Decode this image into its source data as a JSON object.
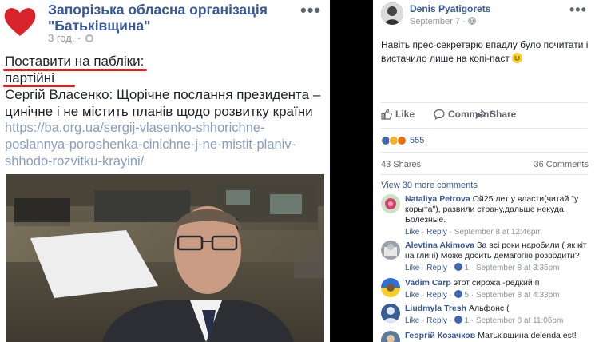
{
  "left_post": {
    "page_name_line1": "Запорізька обласна організація",
    "page_name_line2": "\"Батьківщина\"",
    "time": "3 год.",
    "meta_sep": "·",
    "more": "•••",
    "text_lines": [
      "Поставити на пабліки:",
      "партійні",
      "Сергій Власенко: Щорічне послання президента –",
      "цинічне і не містить планів щодо розвитку країни"
    ],
    "link_lines": [
      "https://ba.org.ua/sergij-vlasenko-shhorichne-",
      "poslannya-poroshenka-cinichne-j-ne-mistit-planiv-",
      "shhodo-rozvitku-krayini/"
    ]
  },
  "right_post": {
    "author": "Denis Pyatigorets",
    "date": "September 7 · ",
    "more": "•••",
    "text": "Навіть прес-секретарю впадлу було почитати і вистачило лише на копі-паст ",
    "actions": {
      "like": "Like",
      "comment": "Comment",
      "share": "Share"
    },
    "reaction_count": "555",
    "shares": "43 Shares",
    "comments_count": "36 Comments",
    "view_more": "View 30 more comments",
    "comments": [
      {
        "name": "Nataliya Petrova",
        "text": "Ой25 лет у власти(читай \"у корыта\"), развили страну,дальше некуда. Болезные.",
        "like": "Like",
        "reply": "Reply",
        "likes": "",
        "date": "September 8 at 12:46pm"
      },
      {
        "name": "Alevtina Akimova",
        "text": "За всі роки наробили ( як кіт на глині) Може досить демагогію розводити?",
        "like": "Like",
        "reply": "Reply",
        "likes": "1",
        "date": "September 8 at 3:35pm"
      },
      {
        "name": "Vadim Carp",
        "text": "этот сирожа -редкий п",
        "like": "Like",
        "reply": "Reply",
        "likes": "5",
        "date": "September 8 at 4:33pm"
      },
      {
        "name": "Liudmyla Tresh",
        "text": "Альфонс (",
        "like": "Like",
        "reply": "Reply",
        "likes": "1",
        "date": "September 8 at 11:06pm"
      },
      {
        "name": "Георгій Козачков",
        "text": "Матьківщина delenda est!",
        "like": "Like",
        "reply": "Reply",
        "likes": "",
        "date": ""
      }
    ]
  },
  "colors": {
    "fb_blue": "#365899",
    "text": "#1d2129",
    "meta_gray": "#90949c",
    "underline_red": "#e02020",
    "heart_red": "#d8232a",
    "link_faded": "#8a9fbd"
  }
}
